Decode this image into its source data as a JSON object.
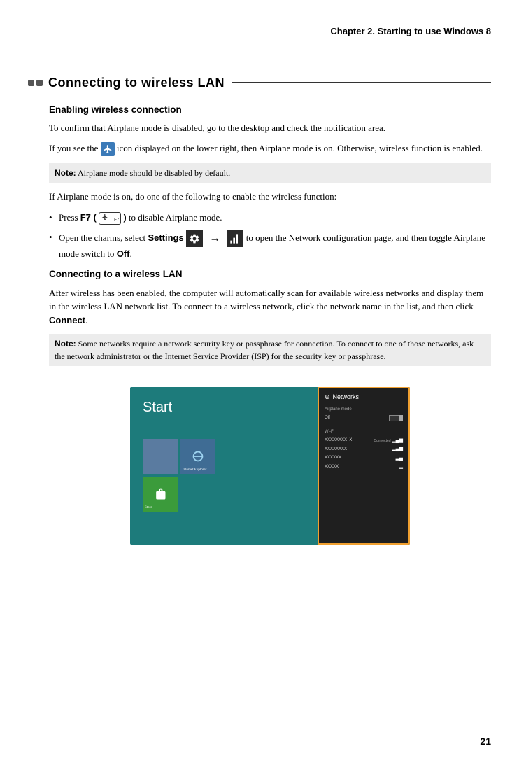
{
  "chapter": "Chapter 2. Starting to use Windows 8",
  "section_title": "Connecting to wireless LAN",
  "sub1": "Enabling wireless connection",
  "p1_pre": "To confirm that Airplane mode is disabled, go to the desktop and check the notification area.",
  "p2_a": "If you see the ",
  "p2_b": " icon displayed on the lower right, then Airplane mode is on. Otherwise, wireless function is enabled.",
  "note1_label": "Note:",
  "note1_text": " Airplane mode should be disabled by default.",
  "p3": "If Airplane mode is on, do one of the following to enable the wireless function:",
  "li1_a": "Press ",
  "li1_b": "F7 (",
  "li1_c": " )",
  "li1_d": " to disable Airplane mode.",
  "li2_a": "Open the charms, select ",
  "li2_b": "Settings",
  "li2_c": " to open the Network configuration page, and then toggle Airplane mode switch to ",
  "li2_d": "Off",
  "li2_e": ".",
  "arrow": "→",
  "sub2": "Connecting to a wireless LAN",
  "p4_a": "After wireless has been enabled, the computer will automatically scan for available wireless networks and display them in the wireless LAN network list. To connect to a wireless network, click the network name in the list, and then click ",
  "p4_b": "Connect",
  "p4_c": ".",
  "note2_label": "Note:",
  "note2_text": " Some networks require a network security key or passphrase for connection. To connect to one of those networks, ask the network administrator or the Internet Service Provider (ISP) for the security key or passphrase.",
  "screenshot": {
    "start_label": "Start",
    "tile_ie": "Internet Explorer",
    "tile_store": "Store",
    "networks_title": "Networks",
    "airplane_label": "Airplane mode",
    "airplane_state": "Off",
    "wifi_label": "Wi-Fi",
    "nets": [
      {
        "name": "XXXXXXXX_X",
        "status": "Connected"
      },
      {
        "name": "XXXXXXXX",
        "status": ""
      },
      {
        "name": "XXXXXX",
        "status": ""
      },
      {
        "name": "XXXXX",
        "status": ""
      }
    ]
  },
  "f7_key": "F7",
  "page_number": "21"
}
